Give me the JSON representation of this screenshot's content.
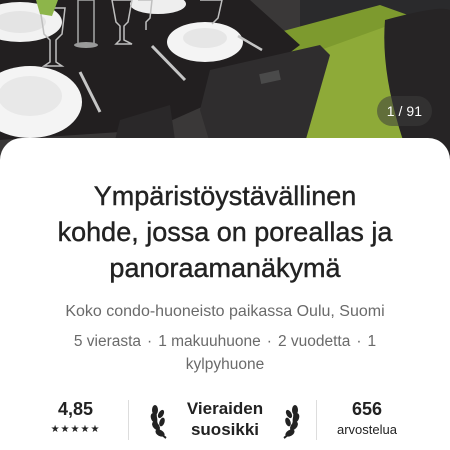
{
  "gallery": {
    "photo_description_icon": "photo-placeholder",
    "counter_current": "1",
    "counter_separator": "/",
    "counter_total": "91"
  },
  "listing": {
    "title_lines": [
      "Ympäristöystävällinen",
      "kohde, jossa on poreallas ja",
      "panoraamanäkymä"
    ],
    "subtitle": "Koko condo-huoneisto paikassa Oulu, Suomi",
    "guests": "5 vierasta",
    "bedrooms": "1 makuuhuone",
    "beds": "2 vuodetta",
    "baths": "1 kylpyhuone",
    "separator": "·"
  },
  "stats": {
    "rating": "4,85",
    "stars": "★★★★★",
    "favorite_line1": "Vieraiden",
    "favorite_line2": "suosikki",
    "reviews_count": "656",
    "reviews_label": "arvostelua"
  },
  "colors": {
    "text_primary": "#222222",
    "text_secondary": "#6a6a6a",
    "divider": "#dddddd"
  }
}
